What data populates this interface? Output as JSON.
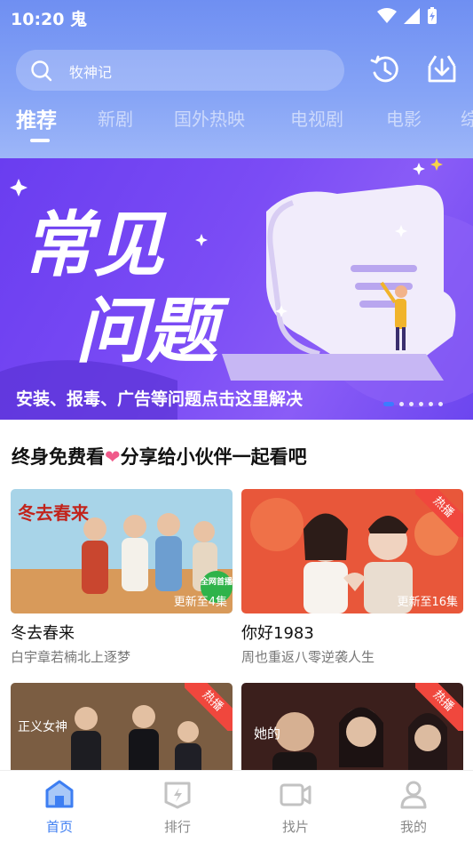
{
  "status": {
    "time": "10:20",
    "app_glyph": "鬼"
  },
  "search": {
    "placeholder": "牧神记"
  },
  "tabs": [
    "推荐",
    "新剧",
    "国外热映",
    "电视剧",
    "电影",
    "综"
  ],
  "banner": {
    "headline_line1": "常见",
    "headline_line2": "问题",
    "caption": "安装、报毒、广告等问题点击这里解决"
  },
  "section": {
    "title_part1": "终身免费看",
    "heart": "❤",
    "title_part2": "分享给小伙伴一起看吧"
  },
  "cards": [
    {
      "title": "冬去春来",
      "subtitle": "白宇章若楠北上逐梦",
      "badge": "更新至4集",
      "poster_text": "冬去春来",
      "tag": "全网首播"
    },
    {
      "title": "你好1983",
      "subtitle": "周也重返八零逆袭人生",
      "badge": "更新至16集",
      "hot": "热播"
    },
    {
      "poster_text": "正义女神",
      "hot": "热播"
    },
    {
      "poster_text": "她的",
      "hot": "热播"
    }
  ],
  "nav": [
    {
      "label": "首页",
      "icon": "home-icon",
      "active": true
    },
    {
      "label": "排行",
      "icon": "ranking-icon"
    },
    {
      "label": "找片",
      "icon": "video-icon"
    },
    {
      "label": "我的",
      "icon": "profile-icon"
    }
  ],
  "colors": {
    "accent": "#3d7ef2",
    "header": "#7b98f4",
    "banner": "#6a3df0",
    "hot": "#f0473d"
  }
}
